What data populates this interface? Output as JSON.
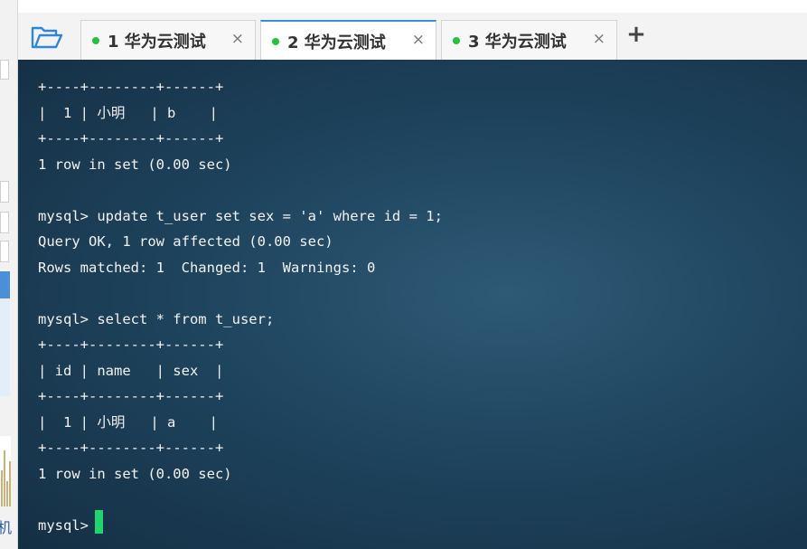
{
  "tabs": [
    {
      "label": "1 华为云测试",
      "close": "×",
      "status_color": "#22c33a",
      "active": false
    },
    {
      "label": "2 华为云测试",
      "close": "×",
      "status_color": "#22c33a",
      "active": true
    },
    {
      "label": "3 华为云测试",
      "close": "×",
      "status_color": "#22c33a",
      "active": false
    }
  ],
  "toolbar": {
    "add_tab_label": "+",
    "open_folder_icon": "folder-open-icon"
  },
  "colors": {
    "active_tab_accent": "#3b8de0",
    "status_dot": "#22c33a",
    "terminal_bg": "#1f445e",
    "terminal_text": "#f2f2f2",
    "cursor": "#21d46b"
  },
  "terminal": {
    "lines": [
      "+----+--------+------+",
      "|  1 | 小明   | b    |",
      "+----+--------+------+",
      "1 row in set (0.00 sec)",
      "",
      "mysql> update t_user set sex = 'a' where id = 1;",
      "Query OK, 1 row affected (0.00 sec)",
      "Rows matched: 1  Changed: 1  Warnings: 0",
      "",
      "mysql> select * from t_user;",
      "+----+--------+------+",
      "| id | name   | sex  |",
      "+----+--------+------+",
      "|  1 | 小明   | a    |",
      "+----+--------+------+",
      "1 row in set (0.00 sec)",
      "",
      "mysql> "
    ]
  },
  "background_window": {
    "edge_char": "机"
  }
}
